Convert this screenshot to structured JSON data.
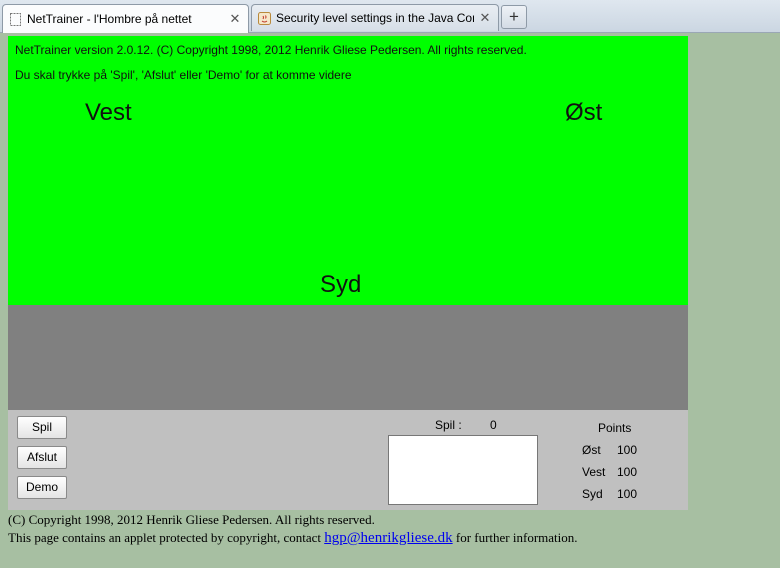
{
  "tabs": [
    {
      "title": "NetTrainer - l'Hombre på nettet",
      "close": "✕"
    },
    {
      "title": "Security level settings in the Java Con...",
      "close": "✕"
    }
  ],
  "new_tab": "+",
  "applet": {
    "version_line": "NetTrainer version 2.0.12. (C) Copyright 1998, 2012 Henrik Gliese Pedersen. All rights reserved.",
    "instruction": "Du skal trykke på 'Spil', 'Afslut' eller 'Demo' for at komme videre",
    "seats": {
      "west": "Vest",
      "east": "Øst",
      "south": "Syd"
    },
    "buttons": {
      "spil": "Spil",
      "afslut": "Afslut",
      "demo": "Demo"
    },
    "spil_label": "Spil :",
    "spil_count": "0",
    "points": {
      "header": "Points",
      "rows": [
        {
          "name": "Øst",
          "value": "100"
        },
        {
          "name": "Vest",
          "value": "100"
        },
        {
          "name": "Syd",
          "value": "100"
        }
      ]
    },
    "colors": {
      "table": "#00ff00",
      "gray": "#808080",
      "panel": "#c0c0c0"
    }
  },
  "footer": {
    "copyright": "(C) Copyright 1998, 2012 Henrik Gliese Pedersen. All rights reserved.",
    "contact_prefix": "This page contains an applet protected by copyright, contact",
    "email": "hgp@henrikgliese.dk",
    "contact_suffix": "for further information."
  }
}
